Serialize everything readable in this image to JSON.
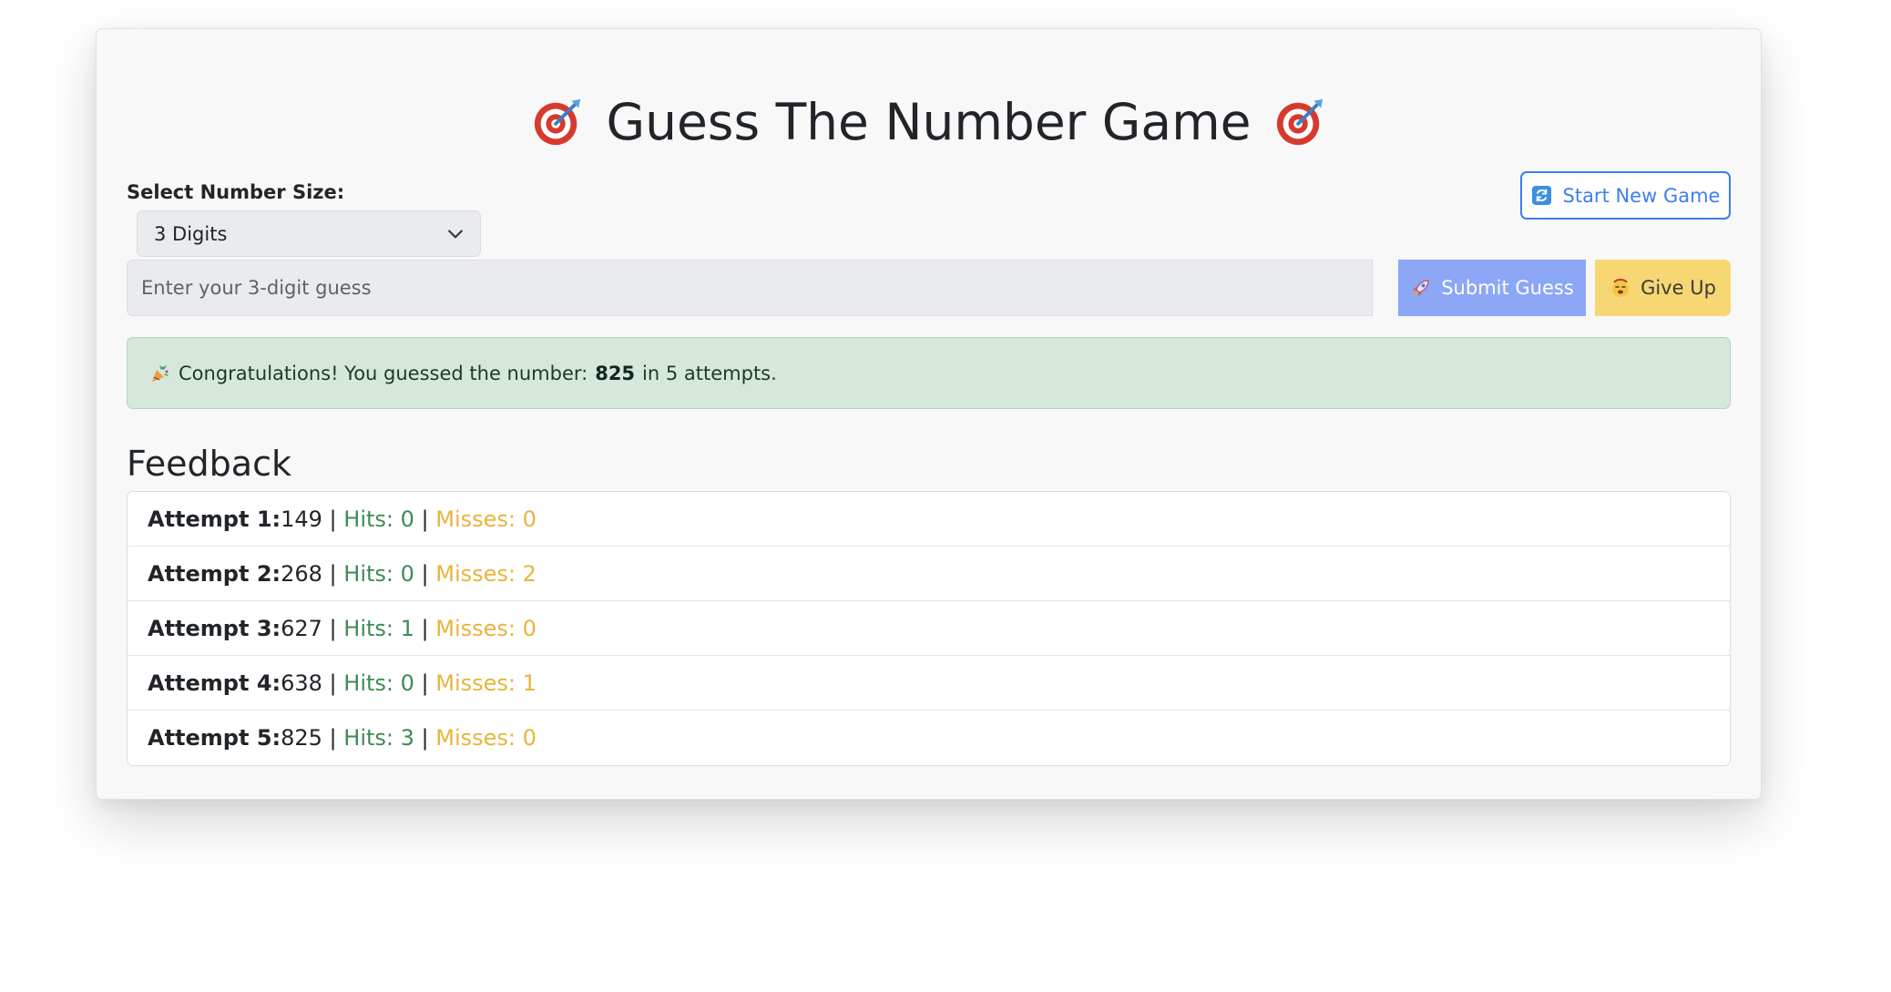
{
  "header": {
    "title": "Guess The Number Game",
    "left_icon": "target-icon",
    "right_icon": "target-icon"
  },
  "controls": {
    "size_label": "Select Number Size:",
    "size_selected": "3 Digits",
    "new_game_label": "Start New Game"
  },
  "guess": {
    "placeholder": "Enter your 3-digit guess",
    "value": "",
    "submit_label": "Submit Guess",
    "giveup_label": "Give Up"
  },
  "alert": {
    "prefix": "Congratulations! You guessed the number:",
    "number": "825",
    "suffix": "in 5 attempts."
  },
  "feedback": {
    "heading": "Feedback",
    "attempts": [
      {
        "label": "Attempt 1:",
        "guess": "149",
        "hits": "Hits: 0",
        "misses": "Misses: 0"
      },
      {
        "label": "Attempt 2:",
        "guess": "268",
        "hits": "Hits: 0",
        "misses": "Misses: 2"
      },
      {
        "label": "Attempt 3:",
        "guess": "627",
        "hits": "Hits: 1",
        "misses": "Misses: 0"
      },
      {
        "label": "Attempt 4:",
        "guess": "638",
        "hits": "Hits: 0",
        "misses": "Misses: 1"
      },
      {
        "label": "Attempt 5:",
        "guess": "825",
        "hits": "Hits: 3",
        "misses": "Misses: 0"
      }
    ]
  },
  "colors": {
    "card_bg": "#f8f8f8",
    "primary": "#3d7ef0",
    "submit_bg": "#8ca7f6",
    "warning_bg": "#f6d773",
    "success_bg": "#d6e7dc",
    "hits": "#3f8a55",
    "misses": "#e8b43c"
  }
}
